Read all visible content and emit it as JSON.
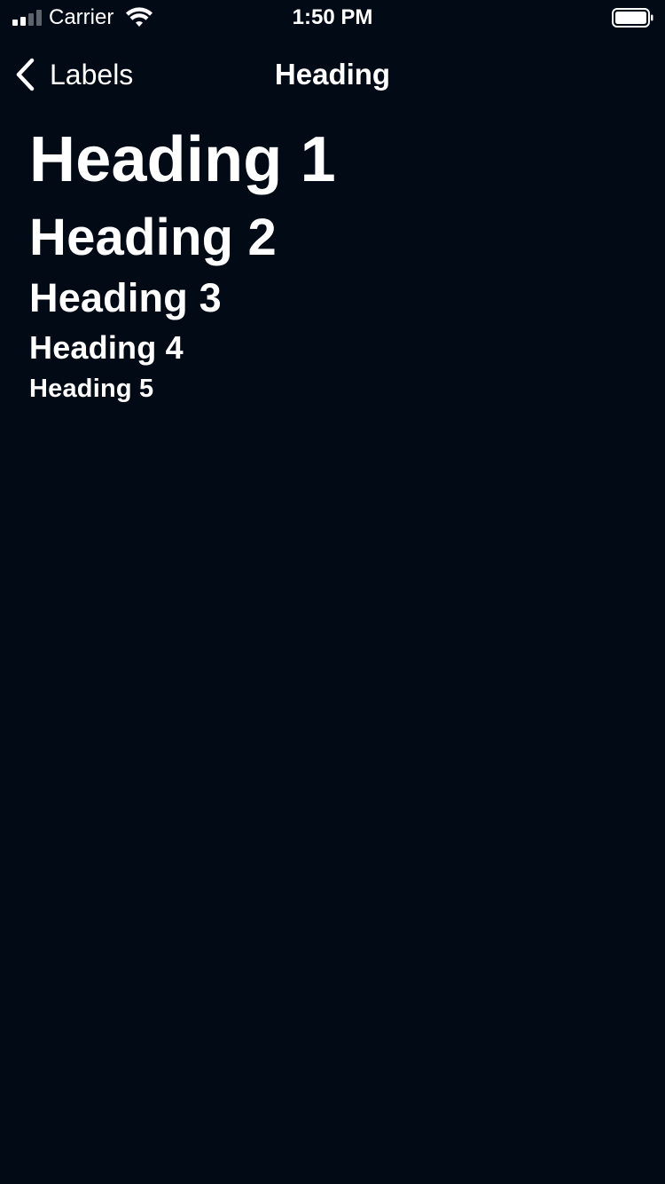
{
  "status_bar": {
    "carrier": "Carrier",
    "time": "1:50 PM",
    "signal_icon": "cellular-signal-icon",
    "wifi_icon": "wifi-icon",
    "battery_icon": "battery-icon"
  },
  "nav": {
    "back_label": "Labels",
    "back_icon": "chevron-left-icon",
    "title": "Heading"
  },
  "headings": {
    "h1": "Heading 1",
    "h2": "Heading 2",
    "h3": "Heading 3",
    "h4": "Heading 4",
    "h5": "Heading 5"
  },
  "colors": {
    "background": "#020a15",
    "text": "#ffffff",
    "signal_dim": "#5d636b"
  }
}
